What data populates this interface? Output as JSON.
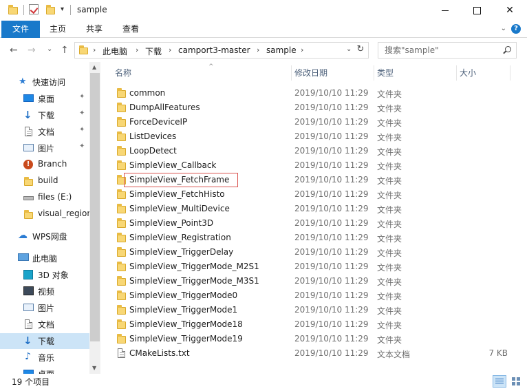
{
  "window": {
    "title": "sample",
    "minimize_glyph": "",
    "maximize_glyph": "",
    "close_glyph": "✕"
  },
  "ribbon": {
    "tabs": [
      {
        "label": "文件",
        "active": true
      },
      {
        "label": "主页"
      },
      {
        "label": "共享"
      },
      {
        "label": "查看"
      }
    ],
    "chevron": "⌄",
    "help": "?"
  },
  "nav": {
    "back": "←",
    "forward": "→",
    "recent": "⌄",
    "up": "↑"
  },
  "address": {
    "breadcrumb": [
      "此电脑",
      "下载",
      "camport3-master",
      "sample"
    ],
    "separator": "›",
    "dropdown": "⌄",
    "refresh": "↻"
  },
  "search": {
    "placeholder": "搜索\"sample\""
  },
  "sidebar": {
    "items": [
      {
        "label": "快速访问",
        "icon": "star-icon"
      },
      {
        "label": "桌面",
        "icon": "desktop-icon",
        "pinned": true
      },
      {
        "label": "下载",
        "icon": "download-icon",
        "pinned": true
      },
      {
        "label": "文档",
        "icon": "document-icon",
        "pinned": true
      },
      {
        "label": "图片",
        "icon": "picture-icon",
        "pinned": true
      },
      {
        "label": "Branch",
        "icon": "branch-warning-icon"
      },
      {
        "label": "build",
        "icon": "folder-icon"
      },
      {
        "label": "files (E:)",
        "icon": "drive-icon"
      },
      {
        "label": "visual_region",
        "icon": "folder-icon"
      },
      {
        "label": "WPS网盘",
        "icon": "cloud-icon"
      },
      {
        "label": "此电脑",
        "icon": "computer-icon"
      },
      {
        "label": "3D 对象",
        "icon": "cube-icon"
      },
      {
        "label": "视频",
        "icon": "video-icon"
      },
      {
        "label": "图片",
        "icon": "picture-icon"
      },
      {
        "label": "文档",
        "icon": "document-icon"
      },
      {
        "label": "下载",
        "icon": "download-icon",
        "selected": true
      },
      {
        "label": "音乐",
        "icon": "music-icon"
      },
      {
        "label": "桌面",
        "icon": "desktop-icon"
      }
    ],
    "pin_glyph": "📌"
  },
  "columns": {
    "name": "名称",
    "modified": "修改日期",
    "type": "类型",
    "size": "大小",
    "sort_glyph": "^"
  },
  "files": [
    {
      "name": "common",
      "modified": "2019/10/10 11:29",
      "type": "文件夹",
      "size": ""
    },
    {
      "name": "DumpAllFeatures",
      "modified": "2019/10/10 11:29",
      "type": "文件夹",
      "size": ""
    },
    {
      "name": "ForceDeviceIP",
      "modified": "2019/10/10 11:29",
      "type": "文件夹",
      "size": ""
    },
    {
      "name": "ListDevices",
      "modified": "2019/10/10 11:29",
      "type": "文件夹",
      "size": ""
    },
    {
      "name": "LoopDetect",
      "modified": "2019/10/10 11:29",
      "type": "文件夹",
      "size": ""
    },
    {
      "name": "SimpleView_Callback",
      "modified": "2019/10/10 11:29",
      "type": "文件夹",
      "size": ""
    },
    {
      "name": "SimpleView_FetchFrame",
      "modified": "2019/10/10 11:29",
      "type": "文件夹",
      "size": "",
      "focused": true
    },
    {
      "name": "SimpleView_FetchHisto",
      "modified": "2019/10/10 11:29",
      "type": "文件夹",
      "size": ""
    },
    {
      "name": "SimpleView_MultiDevice",
      "modified": "2019/10/10 11:29",
      "type": "文件夹",
      "size": ""
    },
    {
      "name": "SimpleView_Point3D",
      "modified": "2019/10/10 11:29",
      "type": "文件夹",
      "size": ""
    },
    {
      "name": "SimpleView_Registration",
      "modified": "2019/10/10 11:29",
      "type": "文件夹",
      "size": ""
    },
    {
      "name": "SimpleView_TriggerDelay",
      "modified": "2019/10/10 11:29",
      "type": "文件夹",
      "size": ""
    },
    {
      "name": "SimpleView_TriggerMode_M2S1",
      "modified": "2019/10/10 11:29",
      "type": "文件夹",
      "size": ""
    },
    {
      "name": "SimpleView_TriggerMode_M3S1",
      "modified": "2019/10/10 11:29",
      "type": "文件夹",
      "size": ""
    },
    {
      "name": "SimpleView_TriggerMode0",
      "modified": "2019/10/10 11:29",
      "type": "文件夹",
      "size": ""
    },
    {
      "name": "SimpleView_TriggerMode1",
      "modified": "2019/10/10 11:29",
      "type": "文件夹",
      "size": ""
    },
    {
      "name": "SimpleView_TriggerMode18",
      "modified": "2019/10/10 11:29",
      "type": "文件夹",
      "size": ""
    },
    {
      "name": "SimpleView_TriggerMode19",
      "modified": "2019/10/10 11:29",
      "type": "文件夹",
      "size": ""
    },
    {
      "name": "CMakeLists.txt",
      "modified": "2019/10/10 11:29",
      "type": "文本文档",
      "size": "7 KB",
      "icon": "text-file-icon"
    }
  ],
  "status": {
    "item_count": "19 个项目"
  },
  "colors": {
    "accent": "#1979ca",
    "folder": "#f8d775",
    "focus_border": "#d9534f",
    "selected_bg": "#cce4f7"
  }
}
